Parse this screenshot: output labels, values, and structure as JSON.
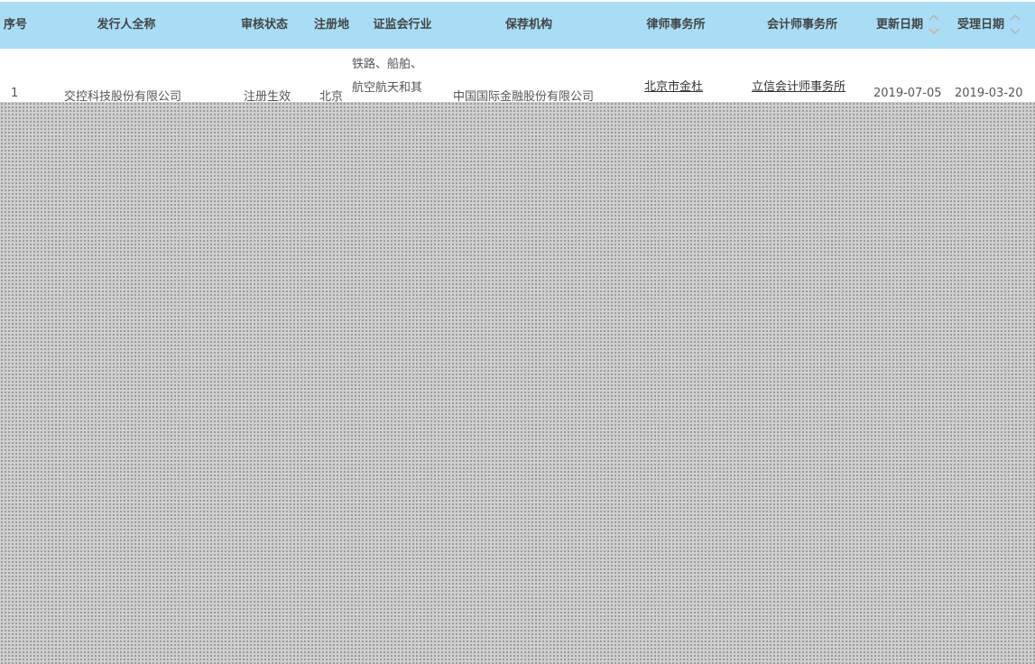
{
  "table": {
    "headers": {
      "index": "序号",
      "issuer": "发行人全称",
      "status": "审核状态",
      "region": "注册地",
      "industry": "证监会行业",
      "sponsor": "保荐机构",
      "law_firm": "律师事务所",
      "accounting_firm": "会计师事务所",
      "update_date": "更新日期",
      "accept_date": "受理日期"
    },
    "rows": [
      {
        "index": "1",
        "issuer": "交控科技股份有限公司",
        "status": "注册生效",
        "region": "北京",
        "industry_lines": [
          "铁路、船舶、",
          "航空航天和其"
        ],
        "sponsor": "中国国际金融股份有限公司",
        "law_firm": "北京市金杜",
        "accounting_firm": "立信会计师事务所",
        "update_date": "2019-07-05",
        "accept_date": "2019-03-20"
      }
    ]
  },
  "colors": {
    "header_bg": "#a8def5",
    "header_text": "#444444",
    "cell_text": "#555555",
    "sort_active": "#f0a080",
    "sort_inactive": "#b0b0b0"
  },
  "icons": {
    "update_sort": "sort-up-down-icon",
    "accept_sort": "sort-up-down-icon"
  }
}
